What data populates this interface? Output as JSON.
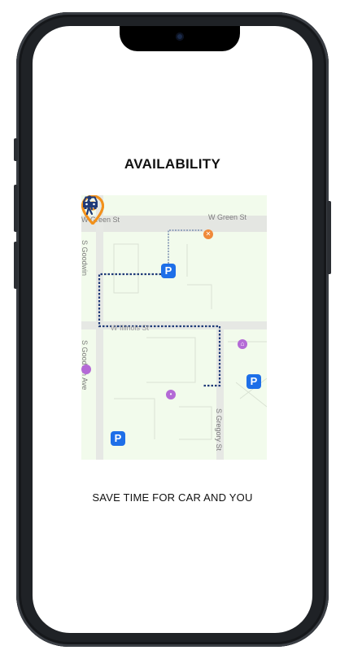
{
  "screen": {
    "title": "AVAILABILITY",
    "tagline": "SAVE TIME FOR CAR AND YOU"
  },
  "map": {
    "streets": {
      "green_west": "W Green St",
      "green_east": "W Green St",
      "goodwin_upper": "S Goodwin",
      "goodwin_lower": "S Goodwin Ave",
      "gregory": "S Gregory St",
      "middle": "W Illinois St"
    },
    "parking_label": "P",
    "icons": {
      "pin": "location-pin-icon",
      "walker": "pedestrian-icon",
      "car": "car-icon",
      "parking": "parking-icon"
    },
    "colors": {
      "pin": "#f2911b",
      "parking": "#1e6fe8",
      "route": "#1f3a78",
      "map_bg": "#f2fbec"
    }
  }
}
